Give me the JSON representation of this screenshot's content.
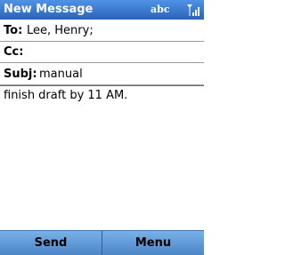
{
  "titlebar": {
    "title": "New Message",
    "input_mode": "abc",
    "signal_icon": "signal-strength-icon"
  },
  "fields": {
    "to": {
      "label": "To:",
      "value": "Lee, Henry;"
    },
    "cc": {
      "label": "Cc:",
      "value": ""
    },
    "subject": {
      "label": "Subj:",
      "value": "manual"
    }
  },
  "body": {
    "text": "finish draft by 11 AM."
  },
  "softkeys": {
    "left": "Send",
    "right": "Menu"
  },
  "colors": {
    "titlebar": "#2f6fc4",
    "softkey_bar": "#5f9ad6",
    "text": "#000000"
  }
}
